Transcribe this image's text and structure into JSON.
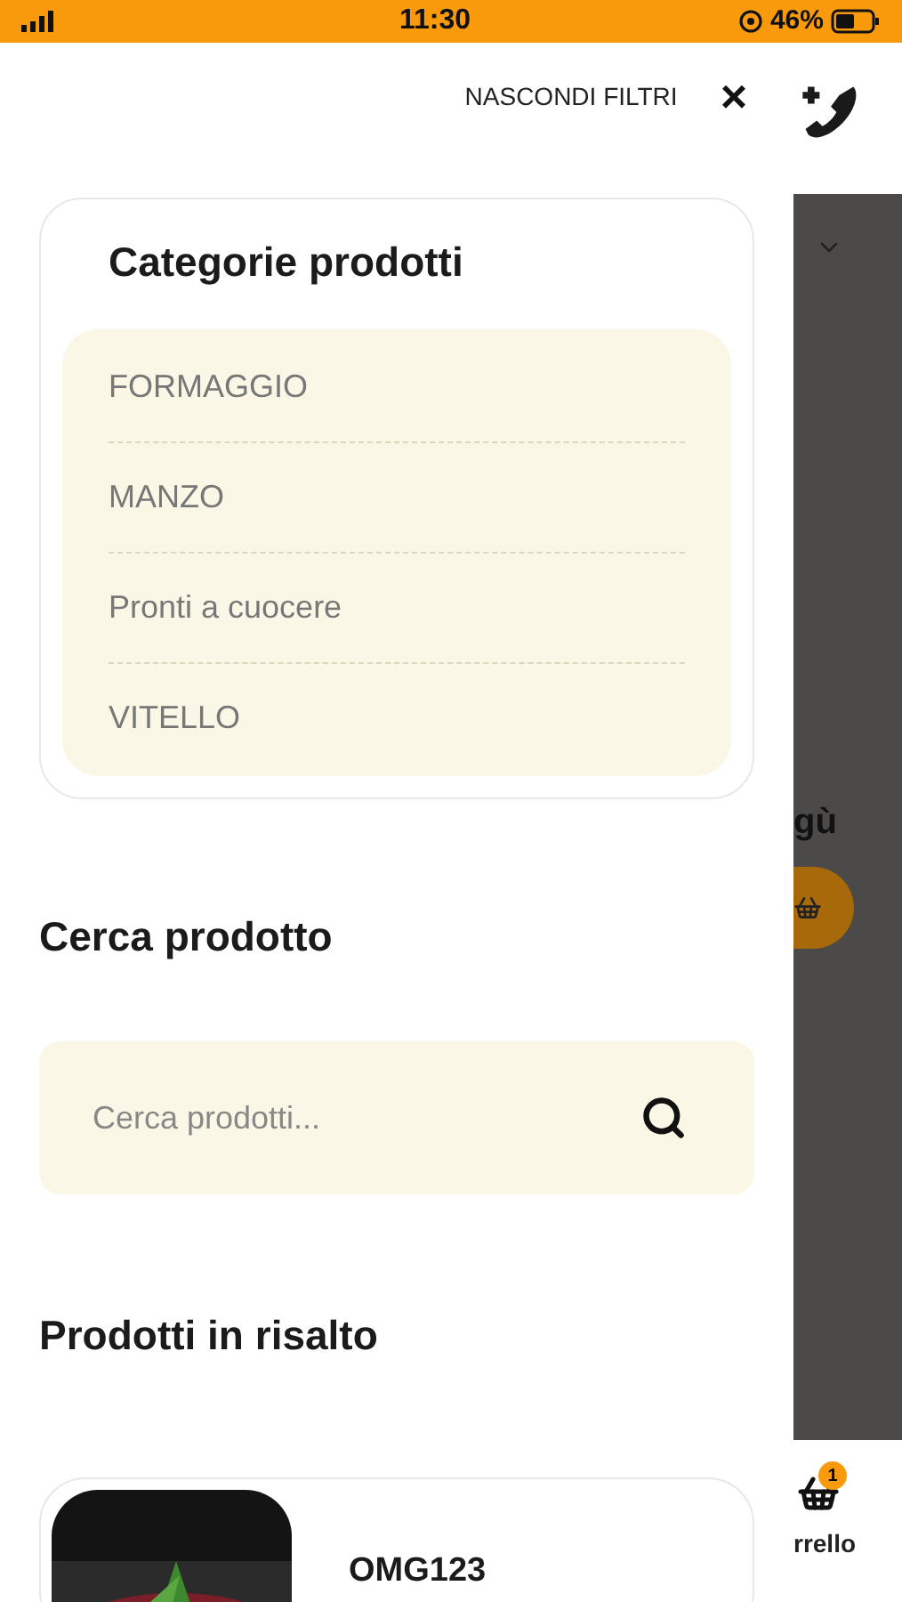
{
  "status_bar": {
    "time": "11:30",
    "battery": "46%"
  },
  "drawer": {
    "hide_filters": "NASCONDI FILTRI",
    "close": "×",
    "categories": {
      "title": "Categorie prodotti",
      "items": [
        "FORMAGGIO",
        "MANZO",
        "Pronti a cuocere",
        "VITELLO"
      ]
    },
    "search": {
      "title": "Cerca prodotto",
      "placeholder": "Cerca prodotti..."
    },
    "featured": {
      "title": "Prodotti in risalto",
      "products": [
        {
          "name": "OMG123"
        }
      ]
    }
  },
  "background": {
    "heading_fragment": "gù",
    "cart": {
      "label_fragment": "rrello",
      "badge": "1"
    }
  }
}
